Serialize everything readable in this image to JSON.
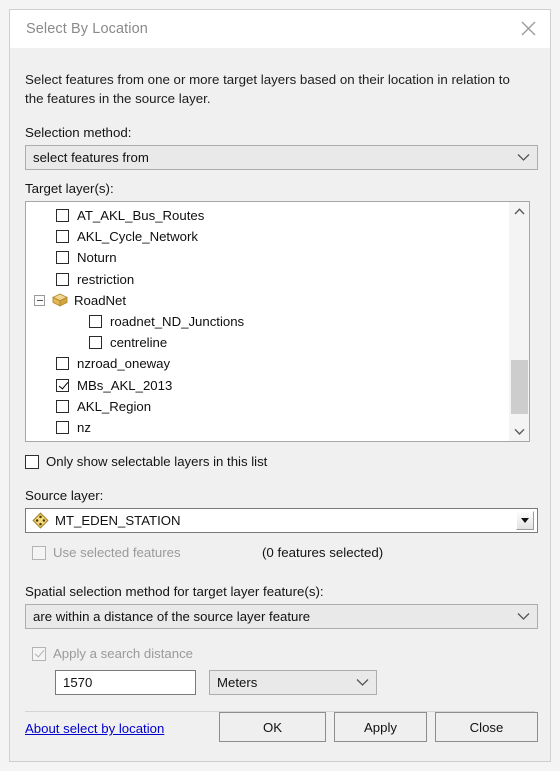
{
  "dialog": {
    "title": "Select By Location",
    "close_icon": "close-icon",
    "description": "Select features from one or more target layers based on their location in relation to the features in the source layer."
  },
  "selection_method": {
    "label": "Selection method:",
    "value": "select features from"
  },
  "target_layers": {
    "label": "Target layer(s):",
    "items": [
      {
        "name": "AT_AKL_Bus_Routes",
        "type": "checkbox",
        "checked": false,
        "indent": 0
      },
      {
        "name": "AKL_Cycle_Network",
        "type": "checkbox",
        "checked": false,
        "indent": 0
      },
      {
        "name": "Noturn",
        "type": "checkbox",
        "checked": false,
        "indent": 0
      },
      {
        "name": "restriction",
        "type": "checkbox",
        "checked": false,
        "indent": 0
      },
      {
        "name": "RoadNet",
        "type": "dataset",
        "expanded": true,
        "indent": 0
      },
      {
        "name": "roadnet_ND_Junctions",
        "type": "checkbox",
        "checked": false,
        "indent": 1
      },
      {
        "name": "centreline",
        "type": "checkbox",
        "checked": false,
        "indent": 1
      },
      {
        "name": "nzroad_oneway",
        "type": "checkbox",
        "checked": false,
        "indent": 0
      },
      {
        "name": "MBs_AKL_2013",
        "type": "checkbox",
        "checked": true,
        "indent": 0
      },
      {
        "name": "AKL_Region",
        "type": "checkbox",
        "checked": false,
        "indent": 0
      },
      {
        "name": "nz",
        "type": "checkbox",
        "checked": false,
        "indent": 0
      }
    ],
    "scrollbar": {
      "up_icon": "chevron-up-icon",
      "down_icon": "chevron-down-icon"
    }
  },
  "only_selectable": {
    "label": "Only show selectable layers in this list",
    "checked": false
  },
  "source_layer": {
    "label": "Source layer:",
    "value": "MT_EDEN_STATION",
    "icon": "point-feature-icon"
  },
  "use_selected": {
    "label": "Use selected features",
    "checked": false,
    "enabled": false,
    "count_text": "(0 features selected)"
  },
  "spatial_method": {
    "label": "Spatial selection method for target layer feature(s):",
    "value": "are within a distance of the source layer feature"
  },
  "search_distance": {
    "label": "Apply a search distance",
    "checked": true,
    "enabled": false,
    "value": "1570",
    "unit": "Meters"
  },
  "footer": {
    "link": "About select by location",
    "ok": "OK",
    "apply": "Apply",
    "close": "Close"
  },
  "colors": {
    "dialog_bg": "#f0f0f0",
    "titlebar_bg": "#ffffff",
    "title_text": "#8a8a8a",
    "link": "#0000cc",
    "dataset_icon": "#e0b54a",
    "point_icon": "#f2d16b"
  }
}
